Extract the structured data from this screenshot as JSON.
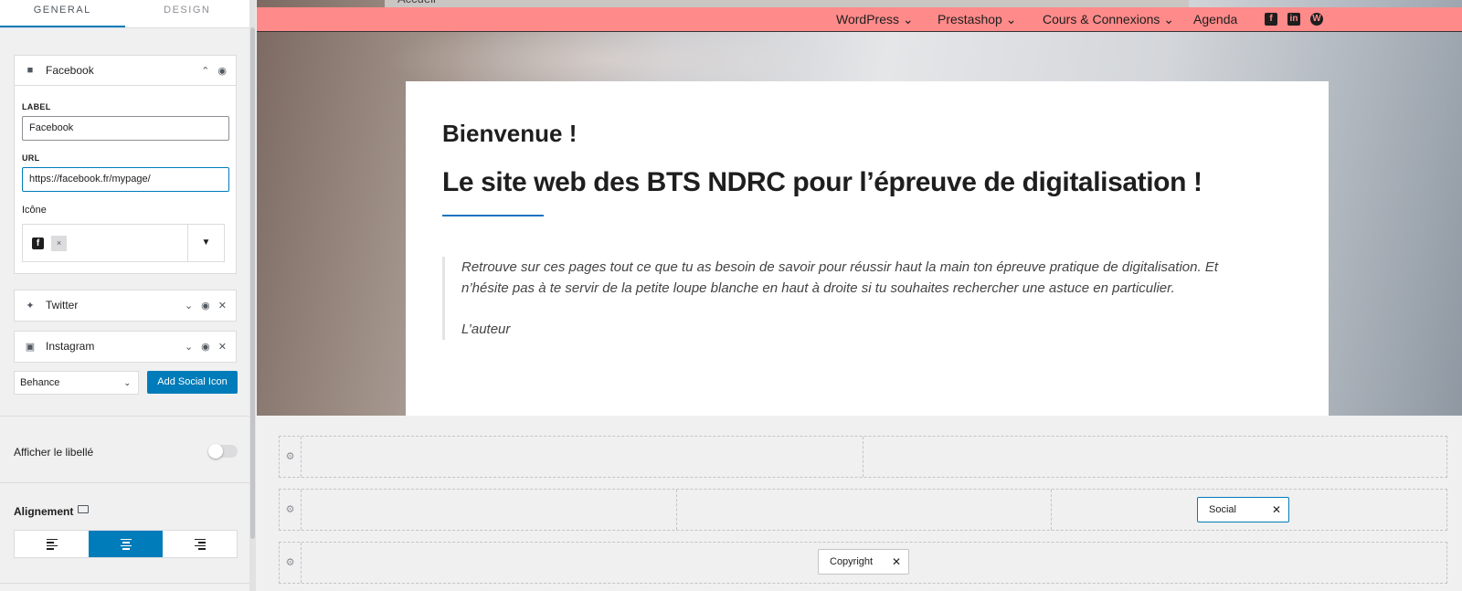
{
  "tabs": {
    "general": "GENERAL",
    "design": "DESIGN"
  },
  "social_items": [
    {
      "name": "Facebook",
      "icon": "facebook-square-icon"
    },
    {
      "name": "Twitter",
      "icon": "twitter-icon"
    },
    {
      "name": "Instagram",
      "icon": "instagram-icon"
    }
  ],
  "facebook_form": {
    "label_caption": "LABEL",
    "label_value": "Facebook",
    "url_caption": "URL",
    "url_value": "https://facebook.fr/mypage/",
    "icon_caption": "Icône",
    "chip_remove": "×"
  },
  "add_social": {
    "select_value": "Behance",
    "button_label": "Add Social Icon"
  },
  "show_label": {
    "label": "Afficher le libellé",
    "on": false
  },
  "alignment": {
    "title": "Alignement",
    "options": [
      "left",
      "center",
      "right"
    ],
    "selected": "center"
  },
  "preview": {
    "breadcrumb": "Accueil",
    "nav": {
      "items": [
        "WordPress",
        "Prestashop",
        "Cours & Connexions",
        "Agenda"
      ],
      "social": [
        "facebook",
        "linkedin",
        "wordpress"
      ],
      "background": "#ff8a8a"
    },
    "welcome": "Bienvenue !",
    "headline": "Le site web des BTS NDRC pour l’épreuve de digitalisation !",
    "quote": "Retrouve sur ces pages tout ce que tu as besoin de savoir pour réussir haut la main ton épreuve pratique de digitalisation. Et n’hésite pas à te servir de la petite loupe blanche en haut à droite si tu souhaites rechercher une astuce en particulier.",
    "author": "L’auteur"
  },
  "footer_builder": {
    "social_chip": "Social",
    "copyright_chip": "Copyright"
  },
  "colors": {
    "accent": "#007cba",
    "nav_bg": "#ff8a8a"
  }
}
